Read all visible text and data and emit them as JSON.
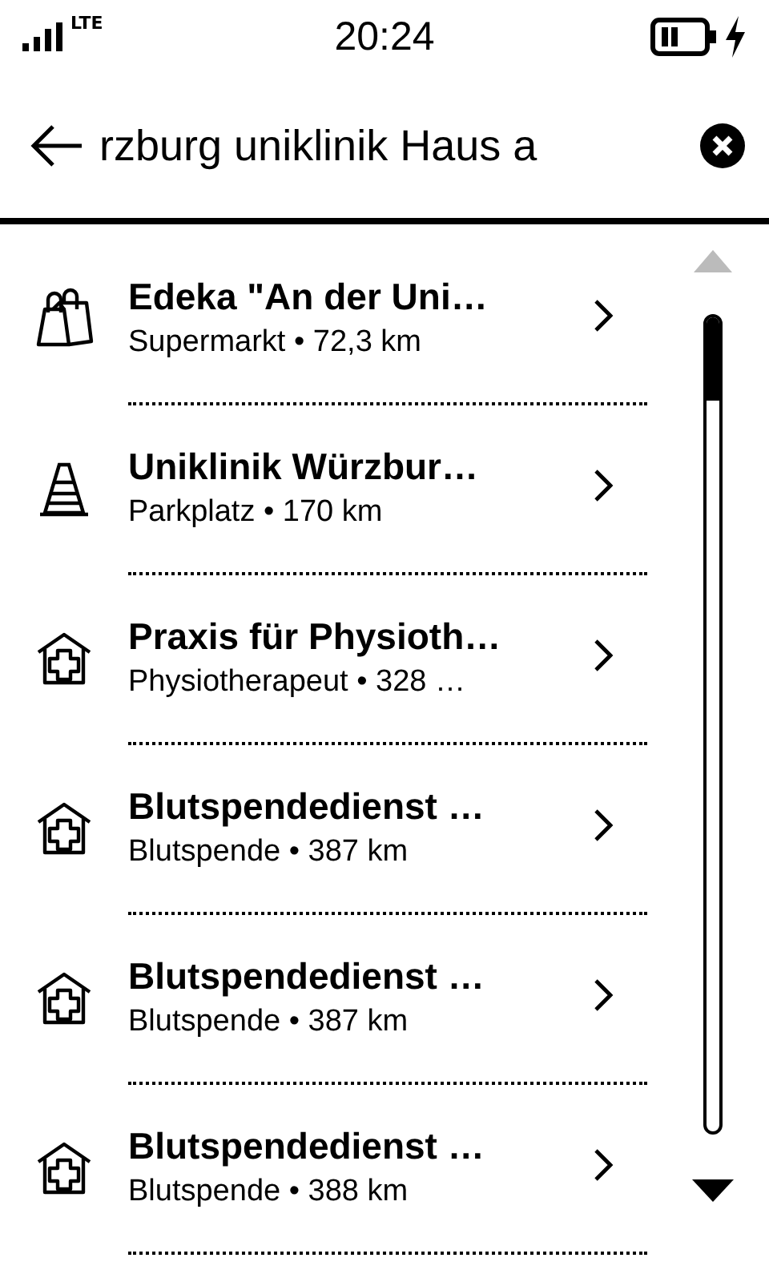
{
  "status_bar": {
    "network": "LTE",
    "time": "20:24"
  },
  "search": {
    "value": "rzburg uniklinik Haus a"
  },
  "results": [
    {
      "kind": "shop",
      "title": "Edeka \"An der Uni…",
      "subtitle": "Supermarkt • 72,3 km"
    },
    {
      "kind": "parking",
      "title": "Uniklinik Würzbur…",
      "subtitle": "Parkplatz • 170 km"
    },
    {
      "kind": "health",
      "title": "Praxis für Physioth…",
      "subtitle": "Physiotherapeut • 328 …"
    },
    {
      "kind": "health",
      "title": "Blutspendedienst …",
      "subtitle": "Blutspende • 387 km"
    },
    {
      "kind": "health",
      "title": "Blutspendedienst …",
      "subtitle": "Blutspende • 387 km"
    },
    {
      "kind": "health",
      "title": "Blutspendedienst …",
      "subtitle": "Blutspende • 388 km"
    }
  ]
}
